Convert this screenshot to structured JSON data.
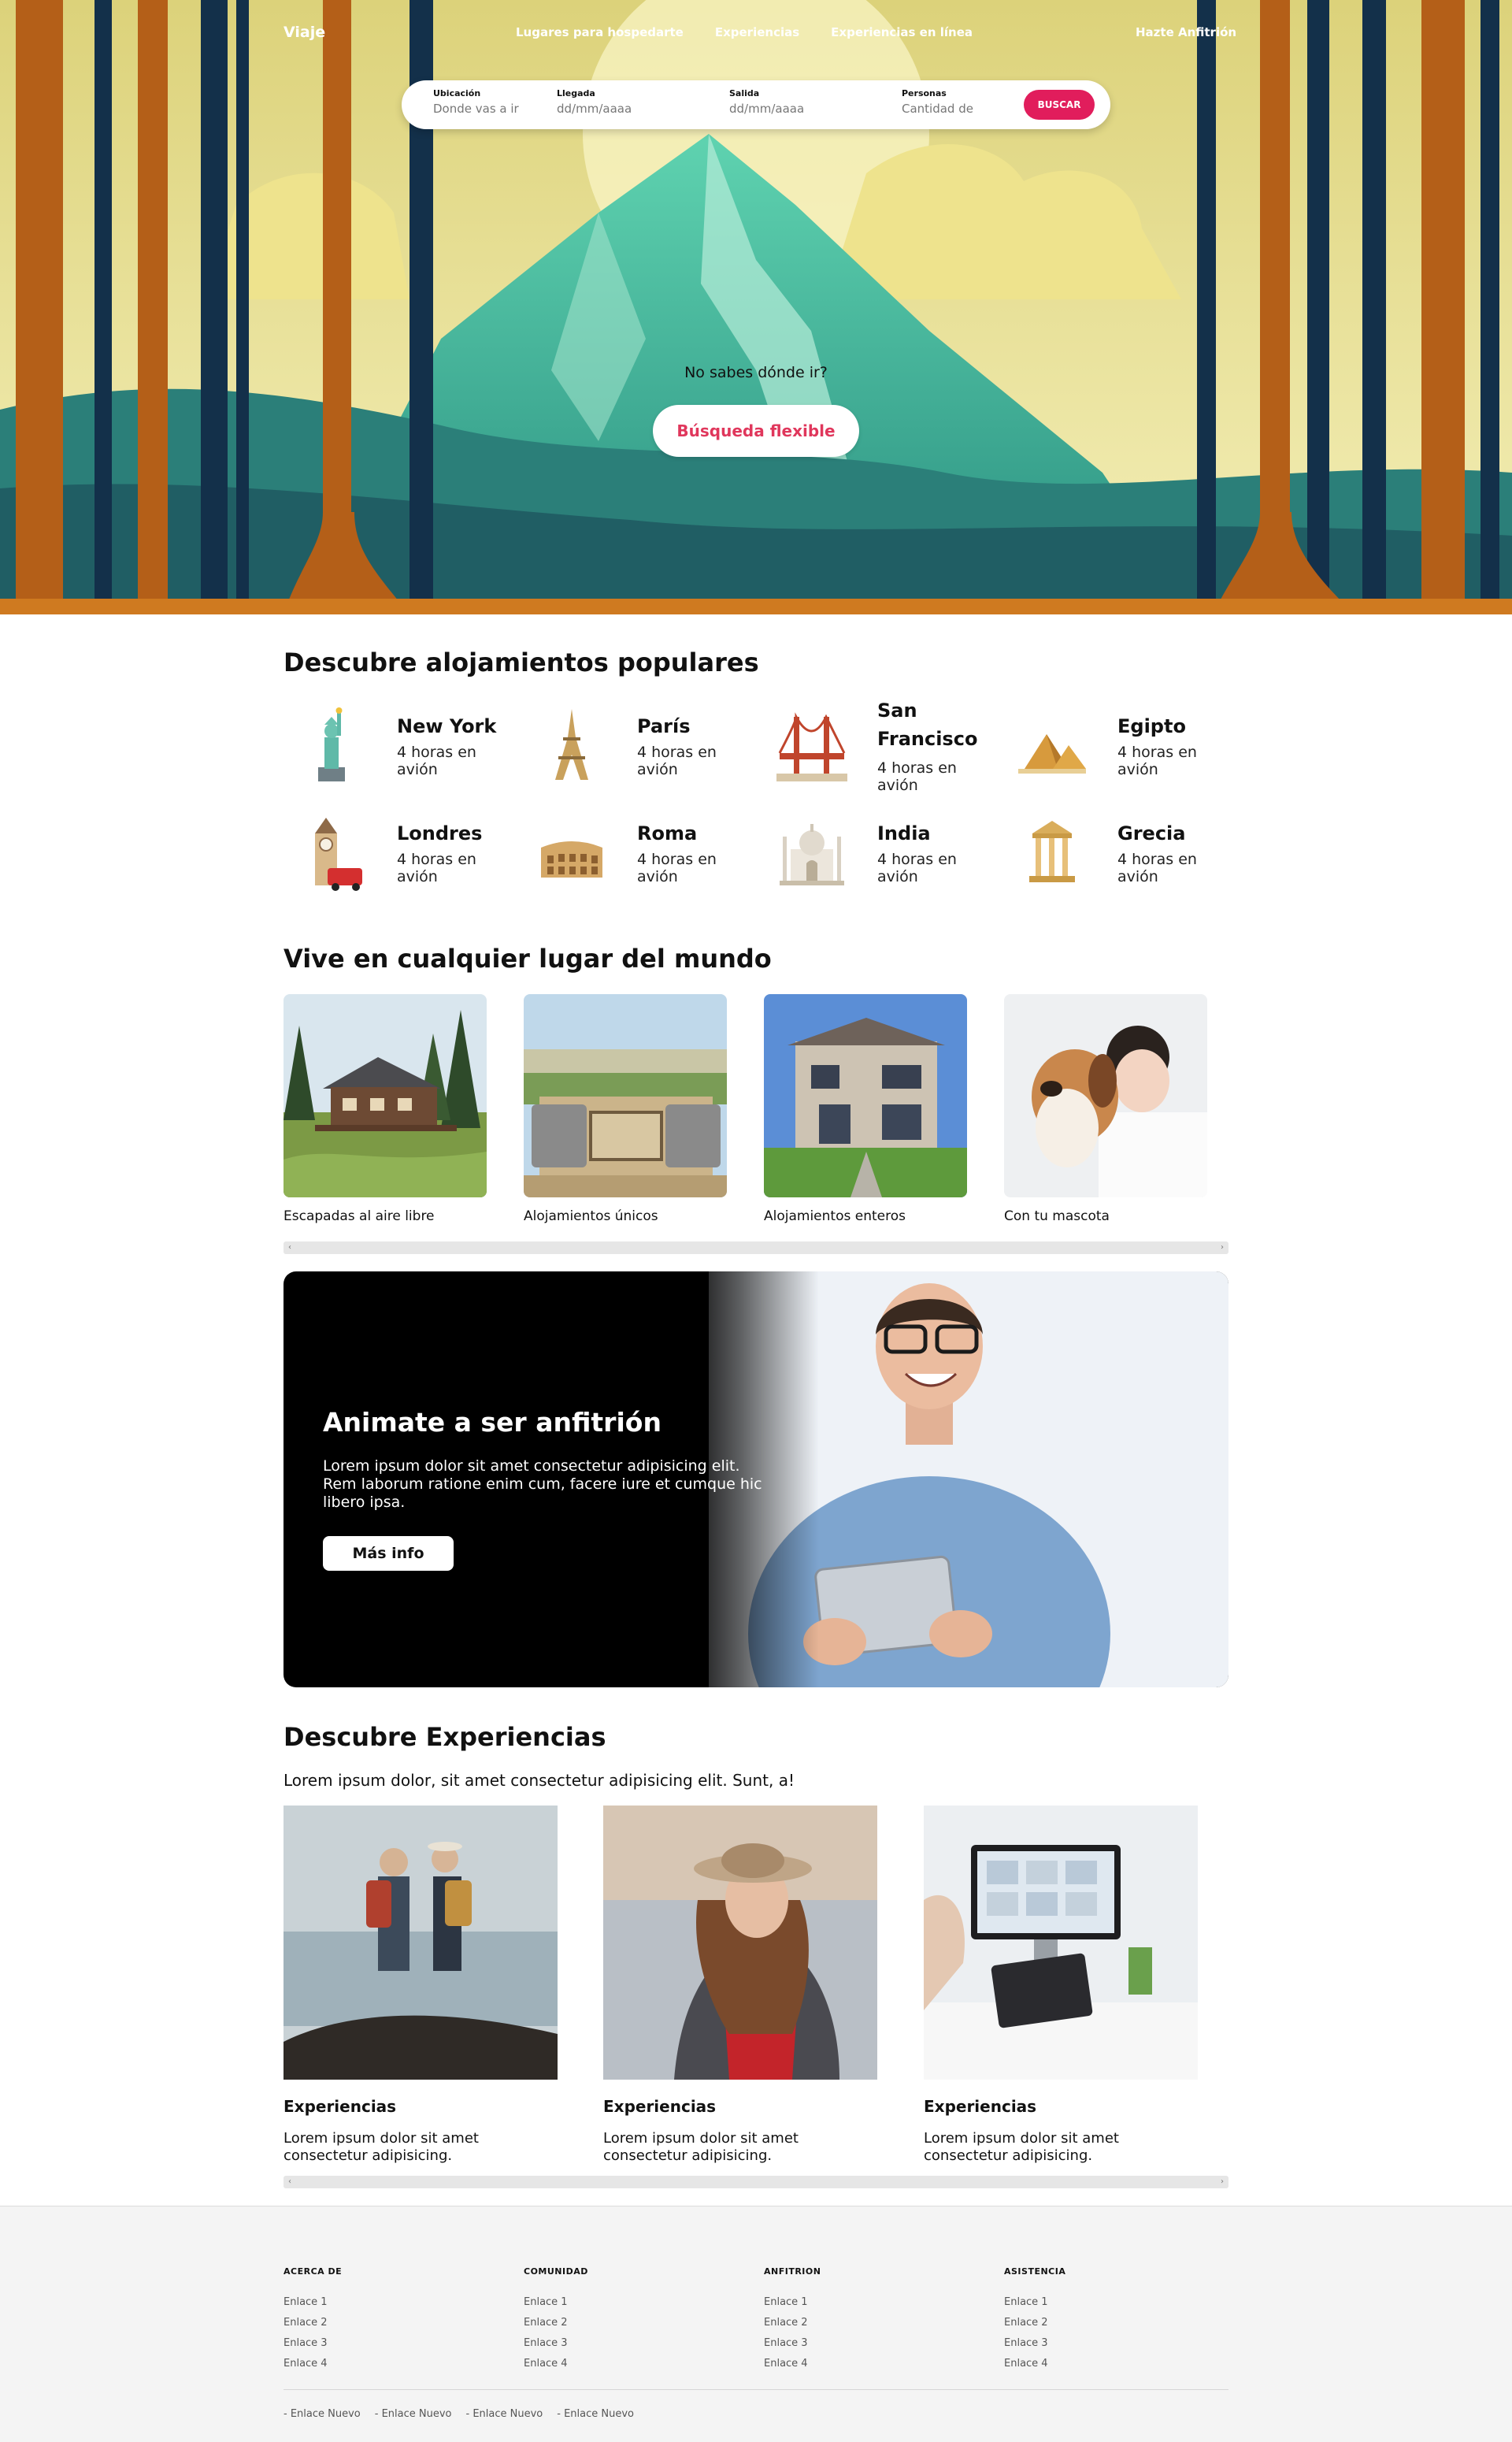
{
  "nav": {
    "brand": "Viaje",
    "links": [
      "Lugares para hospedarte",
      "Experiencias",
      "Experiencias en línea"
    ],
    "host": "Hazte Anfitrión"
  },
  "search": {
    "location_label": "Ubicación",
    "location_placeholder": "Donde vas a ir",
    "checkin_label": "Llegada",
    "checkin_placeholder": "dd/mm/aaaa",
    "checkout_label": "Salida",
    "checkout_placeholder": "dd/mm/aaaa",
    "guests_label": "Personas",
    "guests_placeholder": "Cantidad de",
    "button": "BUSCAR"
  },
  "hero": {
    "question": "No sabes dónde ir?",
    "button": "Búsqueda flexible"
  },
  "popular": {
    "title": "Descubre alojamientos populares",
    "items": [
      {
        "name": "New York",
        "sub": "4 horas en avión",
        "icon": "statue-of-liberty-icon"
      },
      {
        "name": "París",
        "sub": "4 horas en avión",
        "icon": "eiffel-tower-icon"
      },
      {
        "name": "San Francisco",
        "sub": "4 horas en avión",
        "icon": "golden-gate-icon"
      },
      {
        "name": "Egipto",
        "sub": "4 horas en avión",
        "icon": "pyramids-icon"
      },
      {
        "name": "Londres",
        "sub": "4 horas en avión",
        "icon": "big-ben-icon"
      },
      {
        "name": "Roma",
        "sub": "4 horas en avión",
        "icon": "colosseum-icon"
      },
      {
        "name": "India",
        "sub": "4 horas en avión",
        "icon": "taj-mahal-icon"
      },
      {
        "name": "Grecia",
        "sub": "4 horas en avión",
        "icon": "greek-temple-icon"
      }
    ]
  },
  "live": {
    "title": "Vive en cualquier lugar del mundo",
    "cards": [
      "Escapadas al aire libre",
      "Alojamientos únicos",
      "Alojamientos enteros",
      "Con tu mascota"
    ]
  },
  "host_banner": {
    "title": "Animate a ser anfitrión",
    "text": "Lorem ipsum dolor sit amet consectetur adipisicing elit. Rem laborum ratione enim cum, facere iure et cumque hic libero ipsa.",
    "button": "Más info"
  },
  "experiences": {
    "title": "Descubre Experiencias",
    "subtitle": "Lorem ipsum dolor, sit amet consectetur adipisicing elit. Sunt, a!",
    "cards": [
      {
        "title": "Experiencias",
        "text": "Lorem ipsum dolor sit amet consectetur adipisicing."
      },
      {
        "title": "Experiencias",
        "text": "Lorem ipsum dolor sit amet consectetur adipisicing."
      },
      {
        "title": "Experiencias",
        "text": "Lorem ipsum dolor sit amet consectetur adipisicing."
      }
    ]
  },
  "footer": {
    "columns": [
      {
        "title": "ACERCA DE",
        "links": [
          "Enlace 1",
          "Enlace 2",
          "Enlace 3",
          "Enlace 4"
        ]
      },
      {
        "title": "COMUNIDAD",
        "links": [
          "Enlace 1",
          "Enlace 2",
          "Enlace 3",
          "Enlace 4"
        ]
      },
      {
        "title": "ANFITRION",
        "links": [
          "Enlace 1",
          "Enlace 2",
          "Enlace 3",
          "Enlace 4"
        ]
      },
      {
        "title": "ASISTENCIA",
        "links": [
          "Enlace 1",
          "Enlace 2",
          "Enlace 3",
          "Enlace 4"
        ]
      }
    ],
    "bottom_links": [
      "- Enlace Nuevo",
      "- Enlace Nuevo",
      "- Enlace Nuevo",
      "- Enlace Nuevo"
    ]
  },
  "colors": {
    "accent": "#e11d5c",
    "flexible_text": "#e0375c",
    "footer_bg": "#f4f4f4"
  }
}
